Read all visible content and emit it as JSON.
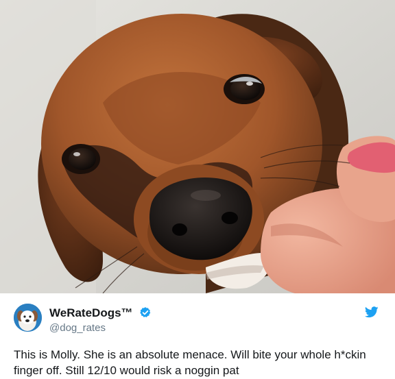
{
  "tweet": {
    "display_name": "WeRateDogs™",
    "handle": "@dog_rates",
    "text": "This is Molly. She is an absolute menace. Will bite your whole h*ckin finger off. Still 12/10 would risk a noggin pat"
  },
  "icons": {
    "verified": "verified-badge-icon",
    "brand": "twitter-bird-icon"
  },
  "colors": {
    "twitter_blue": "#1da1f2",
    "text_primary": "#14171a",
    "text_secondary": "#657786"
  }
}
